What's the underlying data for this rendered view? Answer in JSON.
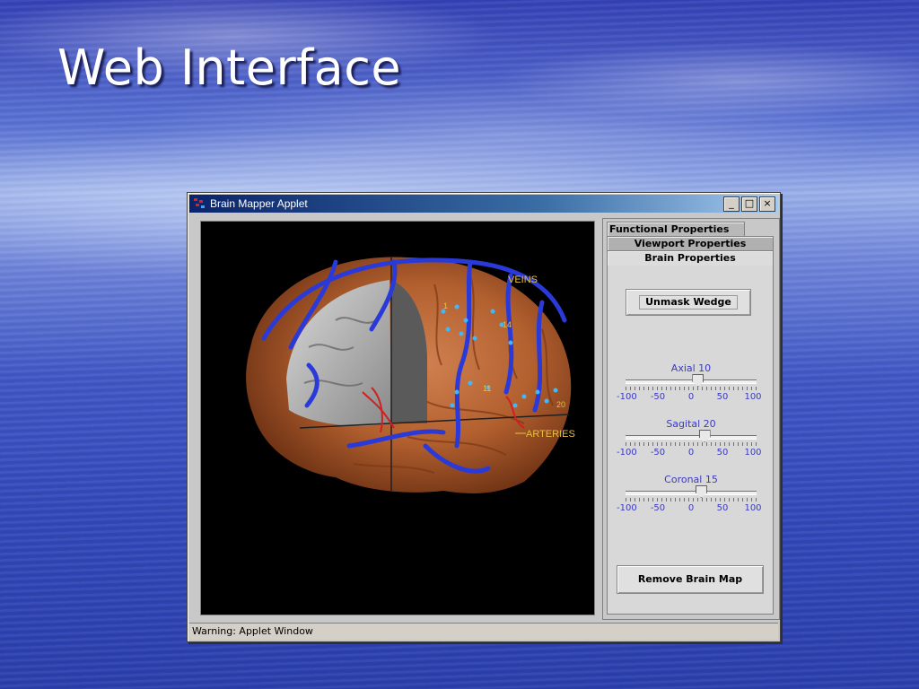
{
  "slide": {
    "title": "Web Interface"
  },
  "window": {
    "title": "Brain Mapper Applet",
    "buttons": {
      "minimize": "_",
      "maximize": "□",
      "close": "×"
    },
    "status": "Warning: Applet Window"
  },
  "viewport": {
    "labels": {
      "veins": "VEINS",
      "arteries": "ARTERIES"
    },
    "markers": [
      "1",
      "14",
      "11",
      "20"
    ]
  },
  "panel": {
    "tabs": {
      "functional": "Functional Properties",
      "viewport": "Viewport Properties",
      "brain": "Brain Properties"
    },
    "active_tab": "Brain Properties",
    "unmask_label": "Unmask Wedge",
    "remove_label": "Remove Brain Map",
    "scale": [
      "-100",
      "-50",
      "0",
      "50",
      "100"
    ],
    "sliders": [
      {
        "label": "Axial  10",
        "value": 10
      },
      {
        "label": "Sagital  20",
        "value": 20
      },
      {
        "label": "Coronal  15",
        "value": 15
      }
    ]
  },
  "colors": {
    "title_bar": "#0a246a",
    "panel": "#c8c8c8",
    "label_blue": "#3a3ac0",
    "annotation": "#e8c040"
  }
}
